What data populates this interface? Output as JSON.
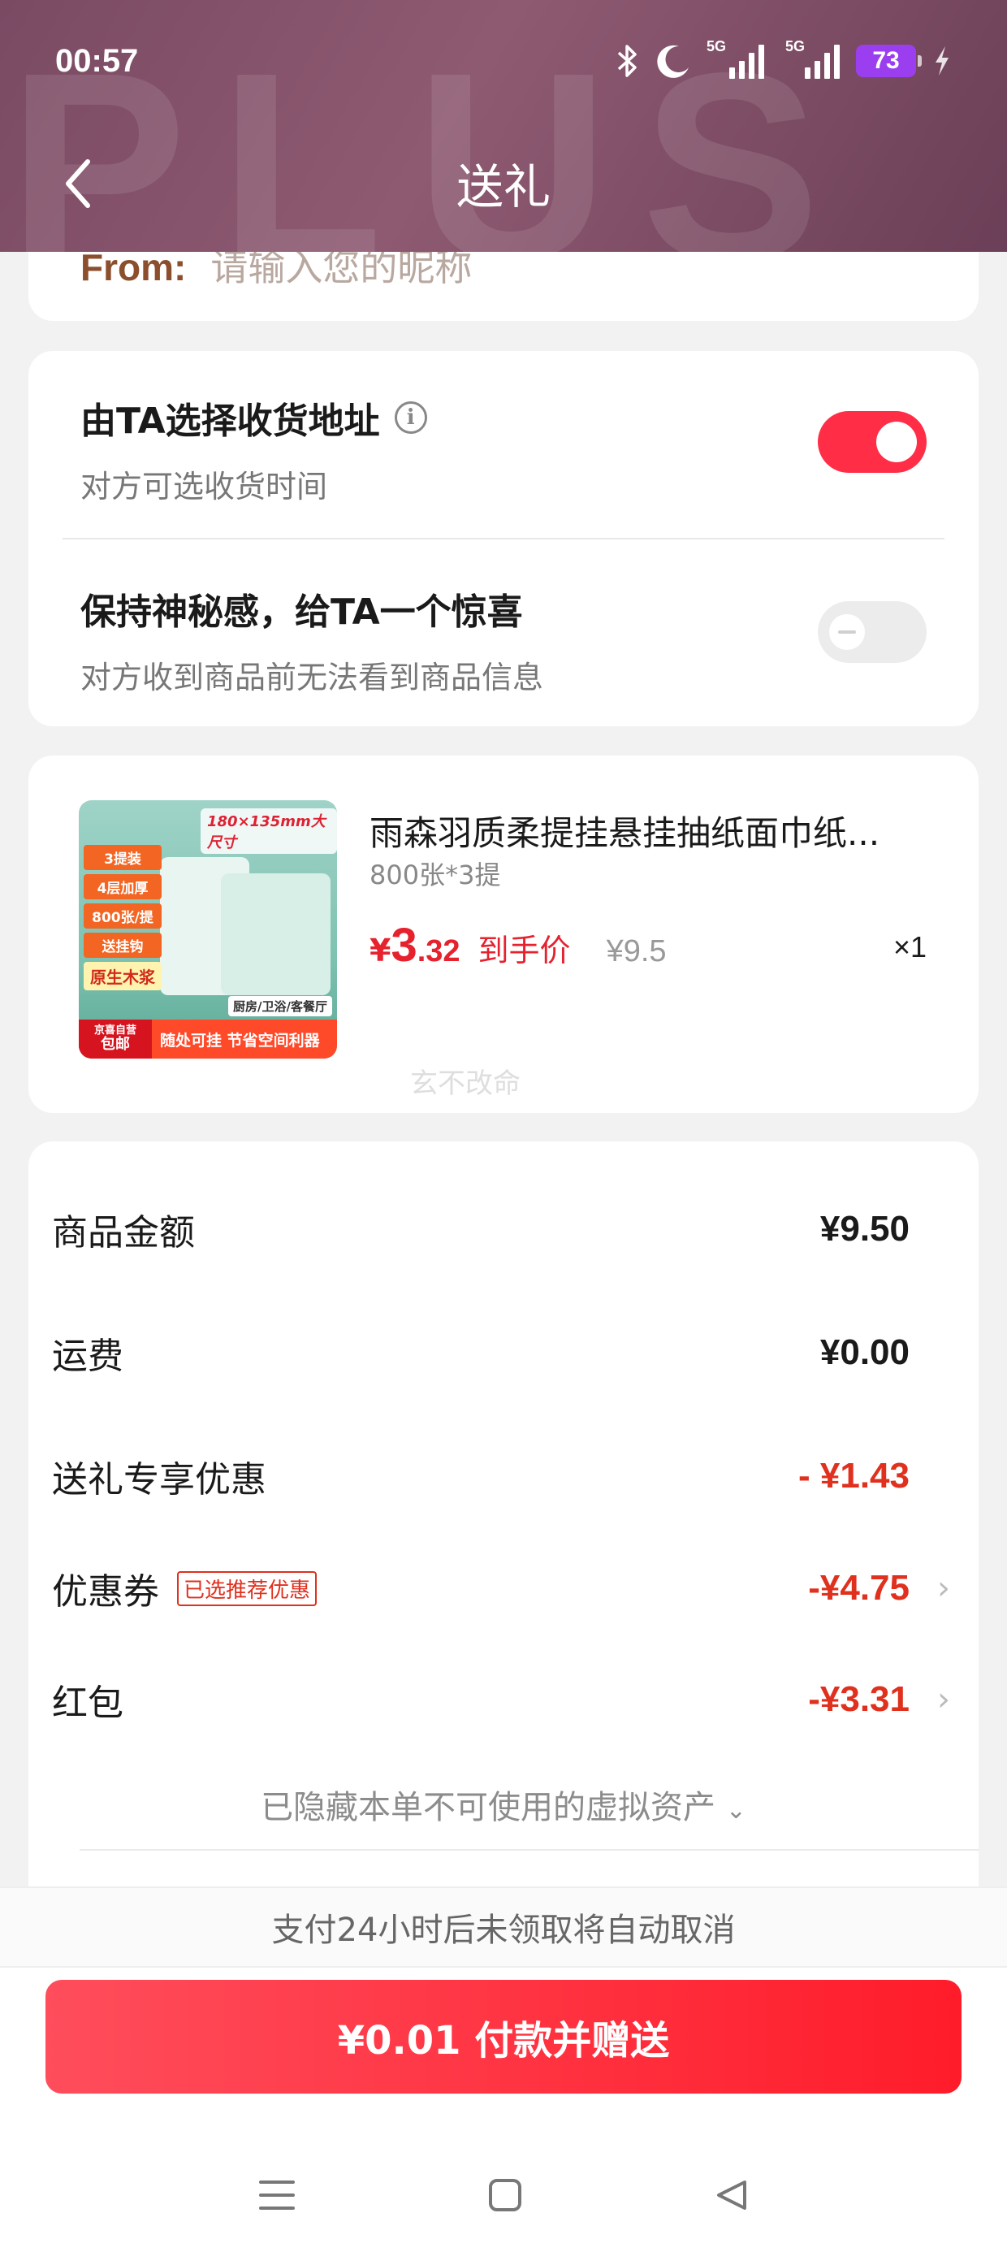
{
  "status_bar": {
    "time": "00:57",
    "network_1": "5G",
    "network_2": "5G",
    "battery": "73"
  },
  "header": {
    "title": "送礼",
    "watermark": "PLUS"
  },
  "from": {
    "label": "From:",
    "placeholder": "请输入您的昵称"
  },
  "options": {
    "address": {
      "title": "由TA选择收货地址",
      "subtitle": "对方可选收货时间",
      "enabled": true
    },
    "mystery": {
      "title": "保持神秘感，给TA一个惊喜",
      "subtitle": "对方收到商品前无法看到商品信息",
      "enabled": false
    }
  },
  "product": {
    "name": "雨森羽质柔提挂悬挂抽纸面巾纸...",
    "spec": "800张*3提",
    "price_currency": "¥",
    "price_int": "3",
    "price_dec": ".32",
    "price_label": "到手价",
    "original_price": "¥9.5",
    "quantity": "×1",
    "overlay": "玄不改命",
    "image_text": {
      "size": "180×135mm大尺寸",
      "tags": [
        "3提装",
        "4层加厚",
        "800张/提",
        "送挂钩",
        "原生木浆"
      ],
      "badge_line1": "京喜自营",
      "badge_line2": "包邮",
      "slogan": "随处可挂 节省空间利器",
      "rooms": "厨房/卫浴/客餐厅"
    }
  },
  "summary": {
    "rows": [
      {
        "label": "商品金额",
        "value": "¥9.50"
      },
      {
        "label": "运费",
        "value": "¥0.00"
      },
      {
        "label": "送礼专享优惠",
        "value": "- ¥1.43"
      },
      {
        "label": "优惠券",
        "badge": "已选推荐优惠",
        "value": "-¥4.75"
      },
      {
        "label": "红包",
        "value": "-¥3.31"
      }
    ],
    "hidden_assets": "已隐藏本单不可使用的虚拟资产"
  },
  "footer": {
    "notice": "支付24小时后未领取将自动取消",
    "pay_button": "¥0.01 付款并赠送"
  },
  "colors": {
    "accent": "#ff2d46",
    "discount": "#e0301e",
    "header_bg": "#7a4a63"
  }
}
